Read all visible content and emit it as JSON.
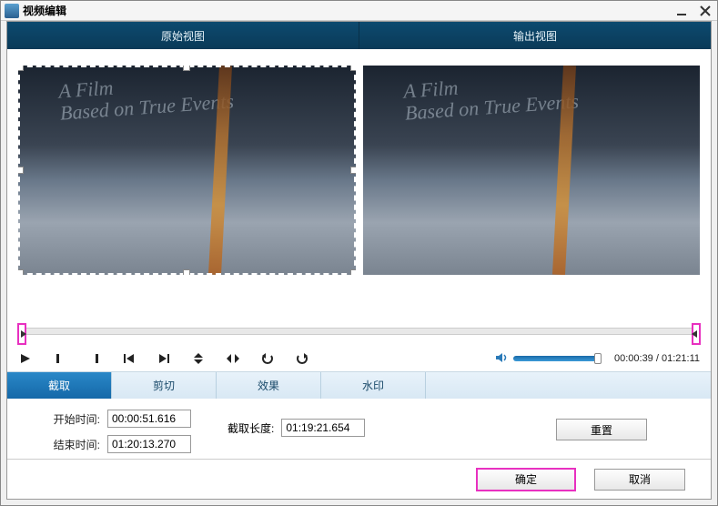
{
  "window": {
    "title": "视频编辑"
  },
  "view_tabs": {
    "original": "原始视图",
    "output": "输出视图"
  },
  "preview_text": {
    "line1": "A Film",
    "line2": "Based on True Events"
  },
  "playback": {
    "time_current": "00:00:39",
    "time_total": "01:21:11"
  },
  "func_tabs": {
    "crop": "截取",
    "trim": "剪切",
    "effect": "效果",
    "watermark": "水印"
  },
  "crop_panel": {
    "start_label": "开始时间:",
    "start_value": "00:00:51.616",
    "end_label": "结束时间:",
    "end_value": "01:20:13.270",
    "length_label": "截取长度:",
    "length_value": "01:19:21.654",
    "reset": "重置"
  },
  "footer": {
    "ok": "确定",
    "cancel": "取消"
  }
}
